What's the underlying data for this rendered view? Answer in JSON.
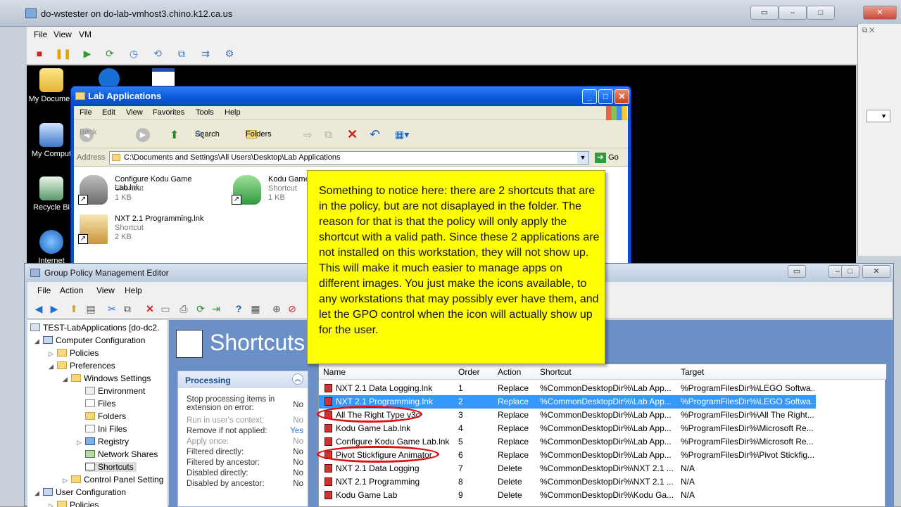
{
  "vm": {
    "title": "do-wstester on do-lab-vmhost3.chino.k12.ca.us",
    "menu": [
      "File",
      "View",
      "VM"
    ],
    "desktop_icons": [
      "My Documen",
      "My Comput",
      "Recycle Bi",
      "Internet"
    ]
  },
  "explorer": {
    "title": "Lab Applications",
    "menu": [
      "File",
      "Edit",
      "View",
      "Favorites",
      "Tools",
      "Help"
    ],
    "back_label": "Back",
    "search_label": "Search",
    "folders_label": "Folders",
    "address_label": "Address",
    "address_value": "C:\\Documents and Settings\\All Users\\Desktop\\Lab Applications",
    "go_label": "Go",
    "files": [
      {
        "name": "Configure Kodu Game Lab.lnk",
        "kind": "Shortcut",
        "size": "1 KB",
        "icon": "kodu-gray-icon"
      },
      {
        "name": "Kodu Game",
        "kind": "Shortcut",
        "size": "1 KB",
        "icon": "kodu-green-icon"
      },
      {
        "name": "NXT 2.1 Programming.lnk",
        "kind": "Shortcut",
        "size": "2 KB",
        "icon": "nxt-box-icon"
      }
    ]
  },
  "gpme": {
    "title": "Group Policy Management Editor",
    "menu": [
      "File",
      "Action",
      "View",
      "Help"
    ],
    "tree": [
      "TEST-LabApplications [do-dc2.",
      "Computer Configuration",
      "Policies",
      "Preferences",
      "Windows Settings",
      "Environment",
      "Files",
      "Folders",
      "Ini Files",
      "Registry",
      "Network Shares",
      "Shortcuts",
      "Control Panel Setting",
      "User Configuration",
      "Policies"
    ],
    "heading": "Shortcuts",
    "processing": {
      "title": "Processing",
      "rows": [
        {
          "label": "Stop processing items in extension on error:",
          "value": "No"
        },
        {
          "label": "Run in user's context:",
          "value": "No"
        },
        {
          "label": "Remove if not applied:",
          "value": "Yes"
        },
        {
          "label": "Apply once:",
          "value": "No"
        },
        {
          "label": "Filtered directly:",
          "value": "No"
        },
        {
          "label": "Filtered by ancestor:",
          "value": "No"
        },
        {
          "label": "Disabled directly:",
          "value": "No"
        },
        {
          "label": "Disabled by ancestor:",
          "value": "No"
        }
      ]
    },
    "columns": [
      "Name",
      "Order",
      "Action",
      "Shortcut",
      "Target"
    ],
    "rows": [
      {
        "name": "NXT 2.1 Data Logging.lnk",
        "order": "1",
        "action": "Replace",
        "shortcut": "%CommonDesktopDir%\\Lab App...",
        "target": "%ProgramFilesDir%\\LEGO Softwa..."
      },
      {
        "name": "NXT 2.1 Programming.lnk",
        "order": "2",
        "action": "Replace",
        "shortcut": "%CommonDesktopDir%\\Lab App...",
        "target": "%ProgramFilesDir%\\LEGO Softwa..."
      },
      {
        "name": "All The Right Type v3c",
        "order": "3",
        "action": "Replace",
        "shortcut": "%CommonDesktopDir%\\Lab App...",
        "target": "%ProgramFilesDir%\\All The Right..."
      },
      {
        "name": "Kodu Game Lab.lnk",
        "order": "4",
        "action": "Replace",
        "shortcut": "%CommonDesktopDir%\\Lab App...",
        "target": "%ProgramFilesDir%\\Microsoft Re..."
      },
      {
        "name": "Configure Kodu Game Lab.lnk",
        "order": "5",
        "action": "Replace",
        "shortcut": "%CommonDesktopDir%\\Lab App...",
        "target": "%ProgramFilesDir%\\Microsoft Re..."
      },
      {
        "name": "Pivot Stickfigure Animator",
        "order": "6",
        "action": "Replace",
        "shortcut": "%CommonDesktopDir%\\Lab App...",
        "target": "%ProgramFilesDir%\\Pivot Stickfig..."
      },
      {
        "name": "NXT 2.1 Data Logging",
        "order": "7",
        "action": "Delete",
        "shortcut": "%CommonDesktopDir%\\NXT 2.1 ...",
        "target": "N/A"
      },
      {
        "name": "NXT 2.1 Programming",
        "order": "8",
        "action": "Delete",
        "shortcut": "%CommonDesktopDir%\\NXT 2.1 ...",
        "target": "N/A"
      },
      {
        "name": "Kodu Game Lab",
        "order": "9",
        "action": "Delete",
        "shortcut": "%CommonDesktopDir%\\Kodu Ga...",
        "target": "N/A"
      }
    ]
  },
  "note": "Something to notice here: there are 2 shortcuts that are in the policy, but are not disaplayed in the folder. The reason for that is that the policy will only apply the shortcut with a valid path. Since these 2 applications are not installed on this workstation, they will not show up. This will make it much easier to manage apps on different images. You just make the icons available, to any workstations that may possibly ever have them, and let the GPO control when the icon will actually show up for the user."
}
